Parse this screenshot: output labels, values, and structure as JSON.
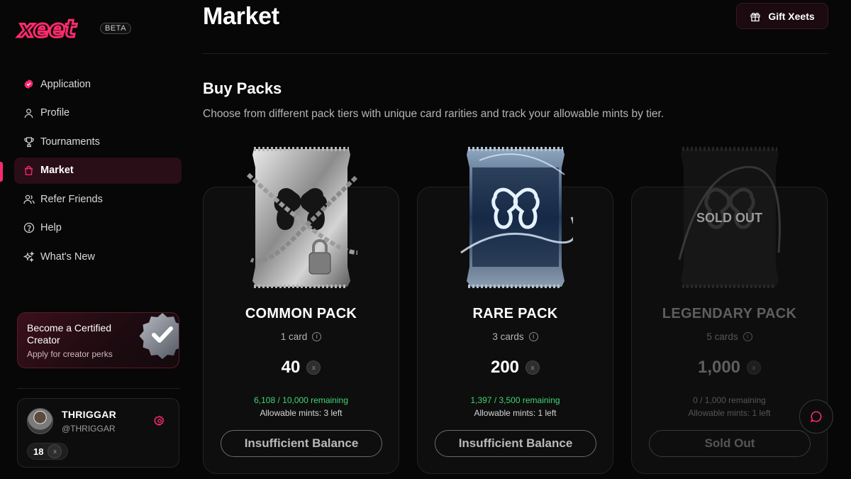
{
  "brand": {
    "logo": "xeet",
    "beta_label": "BETA"
  },
  "sidebar": {
    "items": [
      {
        "label": "Application",
        "icon": "badge-check-icon",
        "active": false
      },
      {
        "label": "Profile",
        "icon": "user-icon",
        "active": false
      },
      {
        "label": "Tournaments",
        "icon": "trophy-icon",
        "active": false
      },
      {
        "label": "Market",
        "icon": "shopping-bag-icon",
        "active": true
      },
      {
        "label": "Refer Friends",
        "icon": "users-icon",
        "active": false
      },
      {
        "label": "Help",
        "icon": "help-circle-icon",
        "active": false
      },
      {
        "label": "What's New",
        "icon": "sparkles-icon",
        "active": false
      }
    ],
    "creator": {
      "title": "Become a Certified Creator",
      "subtitle": "Apply for creator perks"
    },
    "user": {
      "name": "THRIGGAR",
      "handle": "@THRIGGAR",
      "balance": "18"
    }
  },
  "header": {
    "title": "Market",
    "gift_label": "Gift Xeets"
  },
  "section": {
    "title": "Buy Packs",
    "description": "Choose from different pack tiers with unique card rarities and track your allowable mints by tier."
  },
  "packs": [
    {
      "name": "COMMON PACK",
      "cards": "1 card",
      "price": "40",
      "remaining": "6,108 / 10,000 remaining",
      "mints": "Allowable mints: 3 left",
      "button": "Insufficient Balance"
    },
    {
      "name": "RARE PACK",
      "cards": "3 cards",
      "price": "200",
      "remaining": "1,397 / 3,500 remaining",
      "mints": "Allowable mints: 1 left",
      "button": "Insufficient Balance"
    },
    {
      "name": "LEGENDARY PACK",
      "cards": "5 cards",
      "price": "1,000",
      "remaining": "0 / 1,000 remaining",
      "mints": "Allowable mints: 1 left",
      "button": "Sold Out",
      "overlay": "SOLD OUT"
    }
  ],
  "colors": {
    "accent": "#ff2a6d",
    "remaining_green": "#3fd46f",
    "background": "#070707"
  }
}
